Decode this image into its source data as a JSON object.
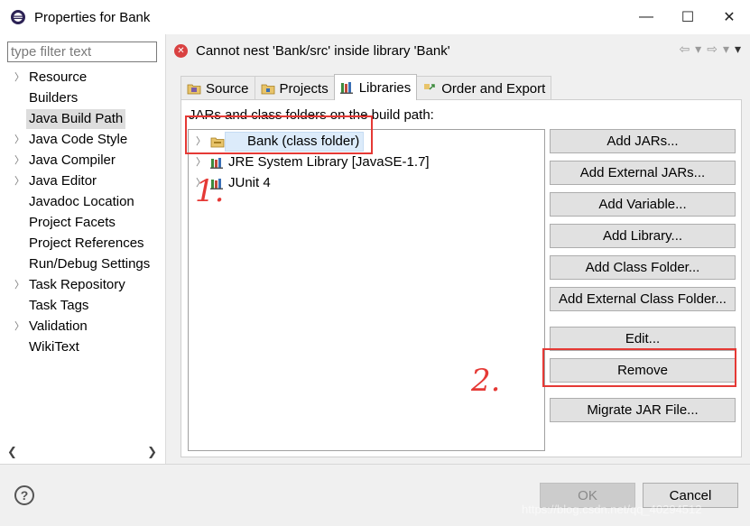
{
  "window": {
    "title": "Properties for Bank",
    "minimize": "—",
    "maximize": "☐",
    "close": "✕"
  },
  "filter": {
    "placeholder": "type filter text"
  },
  "left_tree": [
    {
      "label": "Resource",
      "expandable": true
    },
    {
      "label": "Builders",
      "expandable": false
    },
    {
      "label": "Java Build Path",
      "expandable": false,
      "selected": true
    },
    {
      "label": "Java Code Style",
      "expandable": true
    },
    {
      "label": "Java Compiler",
      "expandable": true
    },
    {
      "label": "Java Editor",
      "expandable": true
    },
    {
      "label": "Javadoc Location",
      "expandable": false
    },
    {
      "label": "Project Facets",
      "expandable": false
    },
    {
      "label": "Project References",
      "expandable": false
    },
    {
      "label": "Run/Debug Settings",
      "expandable": false
    },
    {
      "label": "Task Repository",
      "expandable": true
    },
    {
      "label": "Task Tags",
      "expandable": false
    },
    {
      "label": "Validation",
      "expandable": true
    },
    {
      "label": "WikiText",
      "expandable": false
    }
  ],
  "message": "Cannot nest 'Bank/src' inside library 'Bank'",
  "tabs": [
    {
      "label": "Source",
      "active": false
    },
    {
      "label": "Projects",
      "active": false
    },
    {
      "label": "Libraries",
      "active": true
    },
    {
      "label": "Order and Export",
      "active": false
    }
  ],
  "content_label": "JARs and class folders on the build path:",
  "libraries": [
    {
      "label": "Bank (class folder)",
      "selected": true
    },
    {
      "label": "JRE System Library [JavaSE-1.7]",
      "selected": false
    },
    {
      "label": "JUnit 4",
      "selected": false
    }
  ],
  "buttons": {
    "add_jars": "Add JARs...",
    "add_external_jars": "Add External JARs...",
    "add_variable": "Add Variable...",
    "add_library": "Add Library...",
    "add_class_folder": "Add Class Folder...",
    "add_external_class_folder": "Add External Class Folder...",
    "edit": "Edit...",
    "remove": "Remove",
    "migrate_jar": "Migrate JAR File..."
  },
  "annotations": {
    "step1": "1.",
    "step2": "2."
  },
  "footer": {
    "help": "?",
    "ok": "OK",
    "cancel": "Cancel",
    "watermark": "https://blog.csdn.net/qq_40294512"
  },
  "colors": {
    "annotation": "#e53935",
    "error": "#d94141",
    "selection": "#dcebfa"
  }
}
